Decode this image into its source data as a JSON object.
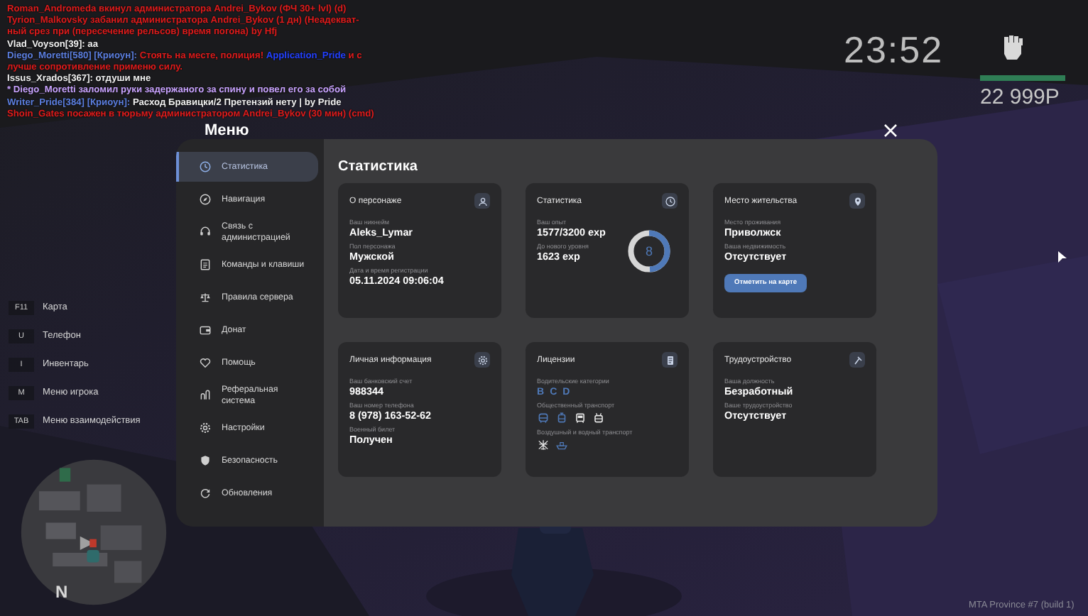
{
  "chat": [
    {
      "parts": [
        {
          "kind": "system",
          "text": "Roman_Andromeda вкинул администратора Andrei_Bykov (ФЧ 30+ lvl) (d)"
        }
      ]
    },
    {
      "parts": [
        {
          "kind": "system",
          "text": "Tyrion_Malkovsky забанил администратора Andrei_Bykov (1 дн) (Неадекват-"
        }
      ]
    },
    {
      "parts": [
        {
          "kind": "system",
          "text": "ный срез при (пересечение рельсов) время погона) by Hfj"
        }
      ]
    },
    {
      "parts": [
        {
          "kind": "speech",
          "text": "Vlad_Voyson[39]: aa"
        }
      ]
    },
    {
      "parts": [
        {
          "kind": "name",
          "text": "Diego_Moretti[580] [Криоун]:"
        },
        {
          "kind": "system",
          "text": " Стоять на месте, полиция!"
        },
        {
          "kind": "highlight",
          "text": " Application_Pride"
        },
        {
          "kind": "system",
          "text": " и с"
        }
      ]
    },
    {
      "parts": [
        {
          "kind": "system",
          "text": "лучше сопротивление применю силу."
        }
      ]
    },
    {
      "parts": [
        {
          "kind": "speech",
          "text": "Issus_Xrados[367]: отдуши мне"
        }
      ]
    },
    {
      "parts": [
        {
          "kind": "action",
          "text": " * Diego_Moretti заломил руки задержаного за спину и повел его за собой"
        }
      ]
    },
    {
      "parts": [
        {
          "kind": "name",
          "text": "Writer_Pride[384] [Криоун]:"
        },
        {
          "kind": "speech",
          "text": " Расход Бравицки/2 Претензий нету | by Pride"
        }
      ]
    },
    {
      "parts": [
        {
          "kind": "system",
          "text": "Shoin_Gates посажен в тюрьму администратором Andrei_Bykov (30 мин) (cmd)"
        }
      ]
    }
  ],
  "hud": {
    "clock": "23:52",
    "money": "22 999Р"
  },
  "hotkeys": [
    {
      "key": "F11",
      "label": "Карта"
    },
    {
      "key": "U",
      "label": "Телефон"
    },
    {
      "key": "I",
      "label": "Инвентарь"
    },
    {
      "key": "M",
      "label": "Меню игрока"
    },
    {
      "key": "TAB",
      "label": "Меню взаимодействия"
    }
  ],
  "compass": "N",
  "build": "MTA Province #7 (build 1)",
  "menu": {
    "title": "Меню",
    "heading": "Статистика",
    "sidebar": [
      {
        "label": "Статистика",
        "selected": true
      },
      {
        "label": "Навигация",
        "selected": false
      },
      {
        "label": "Связь с администрацией",
        "selected": false
      },
      {
        "label": "Команды и клавиши",
        "selected": false
      },
      {
        "label": "Правила сервера",
        "selected": false
      },
      {
        "label": "Донат",
        "selected": false
      },
      {
        "label": "Помощь",
        "selected": false
      },
      {
        "label": "Реферальная система",
        "selected": false
      },
      {
        "label": "Настройки",
        "selected": false
      },
      {
        "label": "Безопасность",
        "selected": false
      },
      {
        "label": "Обновления",
        "selected": false
      }
    ],
    "cards": [
      {
        "title": "О персонаже",
        "sections": [
          {
            "kind": "field",
            "label": "Ваш никнейм",
            "value": "Aleks_Lymar"
          },
          {
            "kind": "field",
            "label": "Пол персонажа",
            "value": "Мужской"
          },
          {
            "kind": "field",
            "label": "Дата и время регистрации",
            "value": "05.11.2024 09:06:04"
          }
        ]
      },
      {
        "title": "Статистика",
        "ring": {
          "value": "8",
          "level": 0.49
        },
        "sections": [
          {
            "kind": "field",
            "label": "Ваш опыт",
            "value": "1577/3200 exp"
          },
          {
            "kind": "field",
            "label": "До нового уровня",
            "value": "1623 exp"
          }
        ]
      },
      {
        "title": "Место жительства",
        "button": "Отметить на карте",
        "sections": [
          {
            "kind": "field",
            "label": "Место проживания",
            "value": "Приволжск"
          },
          {
            "kind": "field",
            "label": "Ваша недвижимость",
            "value": "Отсутствует"
          }
        ]
      },
      {
        "title": "Личная информация",
        "sections": [
          {
            "kind": "field",
            "label": "Ваш банковский счет",
            "value": "988344"
          },
          {
            "kind": "field",
            "label": "Ваш номер телефона",
            "value": "8 (978) 163-52-62"
          },
          {
            "kind": "field",
            "label": "Военный билет",
            "value": "Получен"
          }
        ]
      },
      {
        "title": "Лицензии",
        "sections": [
          {
            "kind": "letters",
            "label": "Водительские категории",
            "items": [
              {
                "text": "B",
                "active": true
              },
              {
                "text": "C",
                "active": true
              },
              {
                "text": "D",
                "active": true
              }
            ]
          },
          {
            "kind": "icons",
            "label": "Общественный транспорт",
            "items": [
              {
                "active": true
              },
              {
                "active": true
              },
              {
                "active": false
              },
              {
                "active": false
              }
            ]
          },
          {
            "kind": "icons",
            "label": "Воздушный и водный транспорт",
            "items": [
              {
                "active": false
              },
              {
                "active": true
              }
            ]
          }
        ]
      },
      {
        "title": "Трудоустройство",
        "sections": [
          {
            "kind": "field",
            "label": "Ваша должность",
            "value": "Безработный"
          },
          {
            "kind": "field",
            "label": "Ваше трудоустройство",
            "value": "Отсутствует"
          }
        ]
      }
    ]
  }
}
